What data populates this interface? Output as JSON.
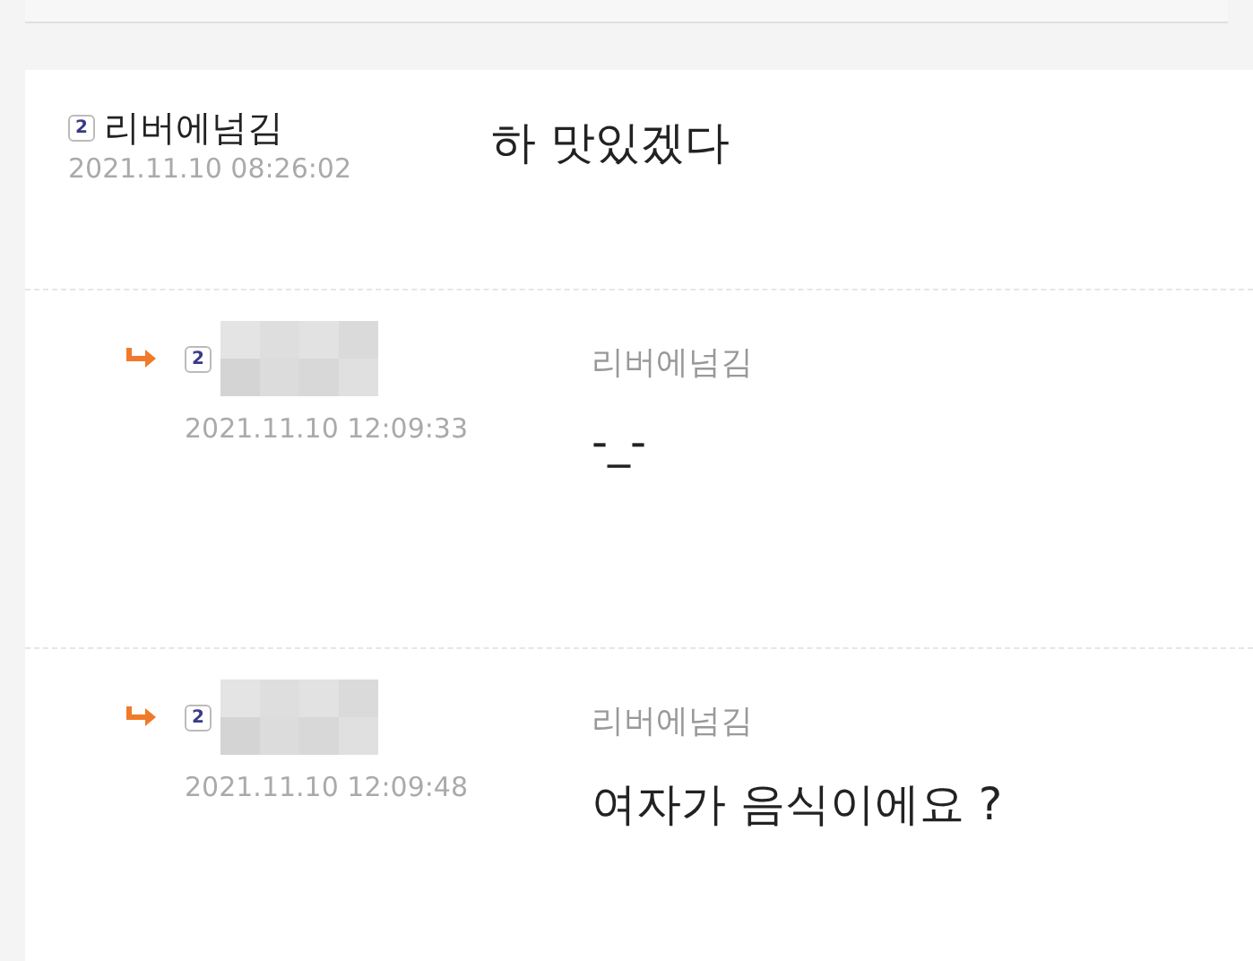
{
  "comments": [
    {
      "kind": "comment",
      "badge": "2",
      "author": {
        "kind": "name",
        "text": "리버에넘김"
      },
      "time": "2021.11.10 08:26:02",
      "text": "하 맛있겠다"
    },
    {
      "kind": "reply",
      "badge": "2",
      "author": {
        "kind": "blurred"
      },
      "time": "2021.11.10 12:09:33",
      "reply_to": "리버에넘김",
      "text": "-_-"
    },
    {
      "kind": "reply",
      "badge": "2",
      "author": {
        "kind": "blurred"
      },
      "time": "2021.11.10 12:09:48",
      "reply_to": "리버에넘김",
      "text": "여자가 음식이에요 ?"
    }
  ]
}
